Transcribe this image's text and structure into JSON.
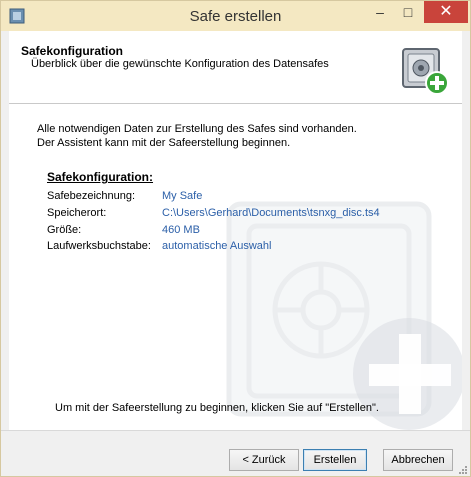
{
  "window": {
    "title": "Safe erstellen",
    "minimize_glyph": "–",
    "maximize_glyph": "□",
    "close_glyph": "✕"
  },
  "header": {
    "title": "Safekonfiguration",
    "subtitle": "Überblick über die gewünschte Konfiguration des Datensafes"
  },
  "content": {
    "intro_line1": "Alle notwendigen Daten zur Erstellung des Safes sind vorhanden.",
    "intro_line2": "Der Assistent kann mit der Safeerstellung beginnen.",
    "section_title": "Safekonfiguration:",
    "rows": [
      {
        "label": "Safebezeichnung:",
        "value": "My Safe"
      },
      {
        "label": "Speicherort:",
        "value": "C:\\Users\\Gerhard\\Documents\\tsnxg_disc.ts4"
      },
      {
        "label": "Größe:",
        "value": "460 MB"
      },
      {
        "label": "Laufwerksbuchstabe:",
        "value": "automatische Auswahl"
      }
    ],
    "bottom_text": "Um mit der Safeerstellung zu beginnen, klicken Sie auf \"Erstellen\"."
  },
  "buttons": {
    "back": "< Zurück",
    "create": "Erstellen",
    "cancel": "Abbrechen"
  },
  "colors": {
    "titlebar": "#f4e8c2",
    "close": "#c9443b",
    "value_link": "#2b5fa8"
  }
}
